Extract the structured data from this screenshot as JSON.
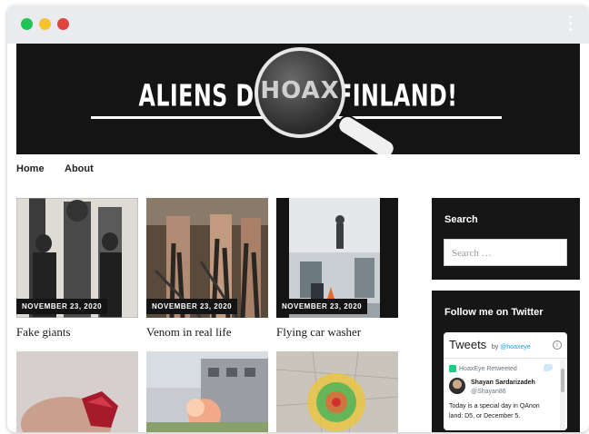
{
  "banner": {
    "title": "ALIENS DISC     IN FINLAND!",
    "lens_word": "HOAX"
  },
  "nav": {
    "items": [
      "Home",
      "About"
    ]
  },
  "posts": [
    {
      "date": "NOVEMBER 23, 2020",
      "title": "Fake giants"
    },
    {
      "date": "NOVEMBER 23, 2020",
      "title": "Venom in real life"
    },
    {
      "date": "NOVEMBER 23, 2020",
      "title": "Flying car washer"
    }
  ],
  "search_widget": {
    "title": "Search",
    "placeholder": "Search …"
  },
  "twitter_widget": {
    "title": "Follow me on Twitter",
    "header": "Tweets",
    "by_prefix": "by",
    "by_handle": "@hoaxeye",
    "retweeted": "HoaxEye Retweeted",
    "author_name": "Shayan Sardarizadeh",
    "author_handle": "@Shayan86",
    "text": "Today is a special day in QAnon land: D5, or December 5."
  },
  "colors": {
    "banner_bg": "#141414",
    "widget_bg": "#161616",
    "twitter_blue": "#1da1f2"
  },
  "icons": {
    "window_controls": [
      "close-dot",
      "minimize-dot",
      "maximize-dot"
    ],
    "menu": "kebab-icon",
    "info": "info-icon",
    "retweet": "retweet-icon",
    "bird": "twitter-bird-icon"
  }
}
